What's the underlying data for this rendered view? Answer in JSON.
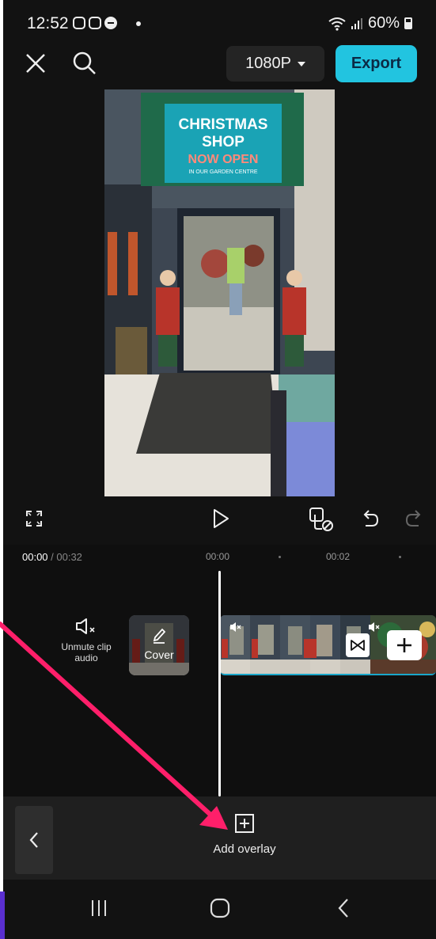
{
  "status_bar": {
    "time": "12:52",
    "battery": "60%"
  },
  "toolbar": {
    "resolution": "1080P",
    "export_label": "Export"
  },
  "preview": {
    "sign_line1": "CHRISTMAS",
    "sign_line2": "SHOP",
    "sign_line3": "NOW OPEN",
    "sign_line4": "IN OUR GARDEN CENTRE"
  },
  "timeline": {
    "current_time": "00:00",
    "total_time": " / 00:32",
    "ticks": [
      "00:00",
      "00:02"
    ],
    "unmute_label": "Unmute clip audio",
    "cover_label": "Cover"
  },
  "bottom_toolbar": {
    "add_overlay_label": "Add overlay"
  },
  "colors": {
    "accent": "#22c4e0",
    "annotation_arrow": "#ff1f6a",
    "background": "#121212"
  }
}
